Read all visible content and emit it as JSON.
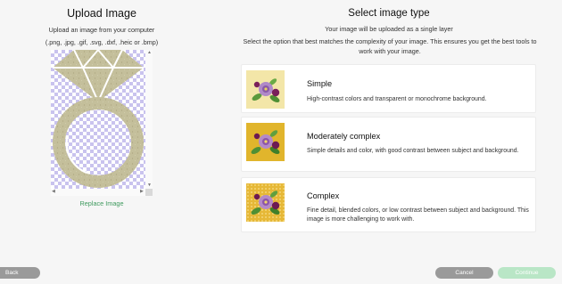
{
  "upload": {
    "title": "Upload Image",
    "subtitle": "Upload an image from your computer",
    "formats": "(.png, .jpg, .gif, .svg, .dxf, .heic or .bmp)",
    "replace_label": "Replace Image",
    "preview_icon": "diamond-ring-image"
  },
  "select": {
    "title": "Select image type",
    "info": "Your image will be uploaded as a single layer",
    "instructions": "Select the option that best matches the complexity of your image. This ensures you get the best tools to work with your image.",
    "options": [
      {
        "title": "Simple",
        "description": "High-contrast colors and transparent or monochrome background.",
        "thumb_bg": "#f3e6a8"
      },
      {
        "title": "Moderately complex",
        "description": "Simple details and color, with good contrast between subject and background.",
        "thumb_bg": "#e1b52c"
      },
      {
        "title": "Complex",
        "description": "Fine detail, blended colors, or low contrast between subject and background. This image is more challenging to work with.",
        "thumb_bg": "#e6b837"
      }
    ]
  },
  "footer": {
    "back_label": "Back",
    "cancel_label": "Cancel",
    "continue_label": "Continue"
  },
  "colors": {
    "accent_green": "#3f9a5e",
    "continue_disabled": "#b9e6c6",
    "button_gray": "#9a9a9a",
    "checker_purple": "#c9c3ee",
    "ring_gold": "#c4bf9b"
  }
}
